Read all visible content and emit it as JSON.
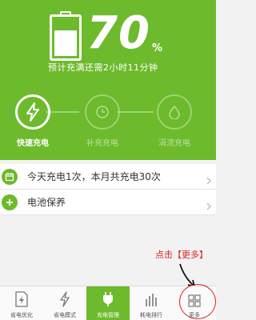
{
  "status": {
    "percent_value": "70",
    "percent_symbol": "%",
    "battery_level": 0.7,
    "eta_text": "预计充满还需2小时11分钟"
  },
  "stages": [
    {
      "label": "快速充电",
      "icon": "lightning-icon",
      "active": true
    },
    {
      "label": "补充充电",
      "icon": "clock-icon",
      "active": false
    },
    {
      "label": "涓流充电",
      "icon": "droplet-icon",
      "active": false
    }
  ],
  "list": [
    {
      "text": "今天充电1次，本月共充电30次",
      "icon": "calendar-icon"
    },
    {
      "text": "电池保养",
      "icon": "plus-icon"
    }
  ],
  "annotation": "点击【更多】",
  "tabs": [
    {
      "label": "省电优化",
      "icon": "document-lightning-icon",
      "active": false
    },
    {
      "label": "省电模式",
      "icon": "lightning-icon",
      "active": false
    },
    {
      "label": "充电管理",
      "icon": "plug-icon",
      "active": true
    },
    {
      "label": "耗电排行",
      "icon": "bar-chart-icon",
      "active": false
    },
    {
      "label": "更多",
      "icon": "grid-icon",
      "active": false
    }
  ],
  "colors": {
    "accent": "#6dba2c",
    "annotation": "#e02020"
  }
}
